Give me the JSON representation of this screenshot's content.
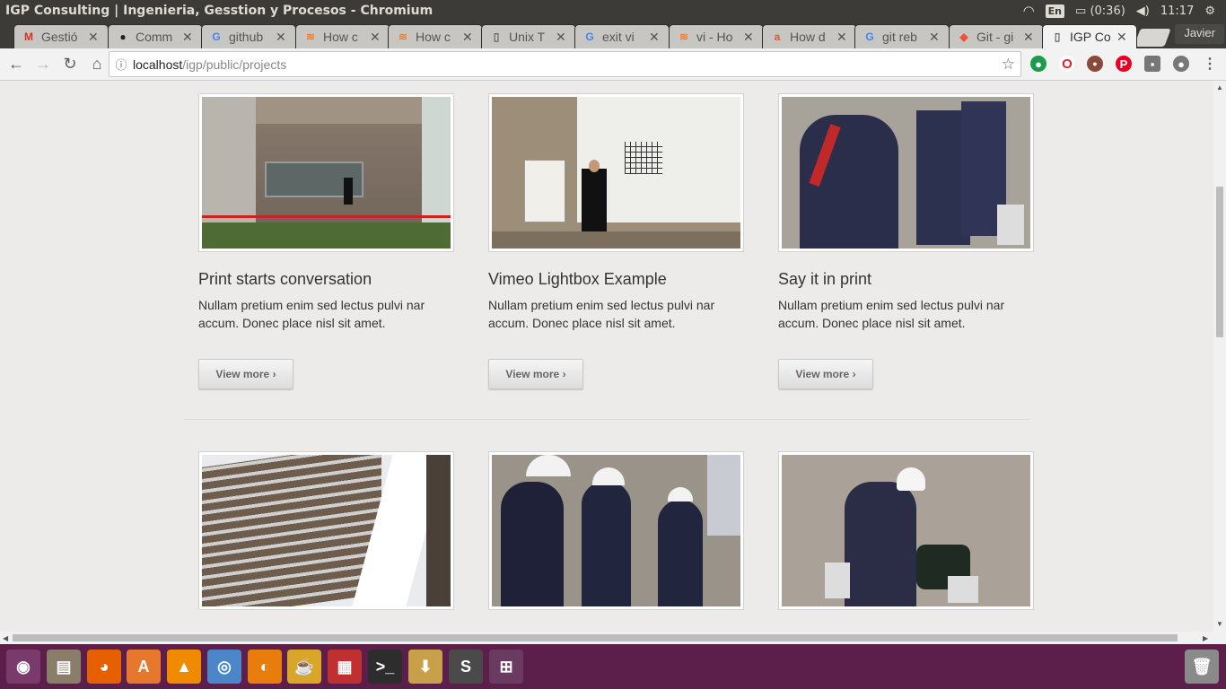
{
  "panel": {
    "window_title": "IGP Consulting | Ingenieria, Gesstion y Procesos - Chromium",
    "language": "En",
    "battery": "(0:36)",
    "clock": "11:17"
  },
  "tabs": [
    {
      "label": "Gestió",
      "icon": "gmail-icon",
      "glyph": "M",
      "color": "#d93025"
    },
    {
      "label": "Comm",
      "icon": "github-icon",
      "glyph": "●",
      "color": "#222222"
    },
    {
      "label": "github",
      "icon": "google-icon",
      "glyph": "G",
      "color": "#4285f4"
    },
    {
      "label": "How c",
      "icon": "stackoverflow-icon",
      "glyph": "≋",
      "color": "#f48024"
    },
    {
      "label": "How c",
      "icon": "stackoverflow-icon",
      "glyph": "≋",
      "color": "#f48024"
    },
    {
      "label": "Unix T",
      "icon": "page-icon",
      "glyph": "▯",
      "color": "#666666"
    },
    {
      "label": "exit vi",
      "icon": "google-icon",
      "glyph": "G",
      "color": "#4285f4"
    },
    {
      "label": "vi - Ho",
      "icon": "stackoverflow-icon",
      "glyph": "≋",
      "color": "#f48024"
    },
    {
      "label": "How d",
      "icon": "askubuntu-icon",
      "glyph": "a",
      "color": "#e95420"
    },
    {
      "label": "git reb",
      "icon": "google-icon",
      "glyph": "G",
      "color": "#4285f4"
    },
    {
      "label": "Git - gi",
      "icon": "git-icon",
      "glyph": "◆",
      "color": "#f05033"
    },
    {
      "label": "IGP Co",
      "icon": "page-icon",
      "glyph": "▯",
      "color": "#666666",
      "active": true
    }
  ],
  "profile_name": "Javier",
  "toolbar": {
    "url_host": "localhost",
    "url_path": "/igp/public/projects"
  },
  "projects": [
    {
      "title": "Print starts conversation",
      "text": "Nullam pretium enim sed lectus pulvi nar accum. Donec place nisl sit amet.",
      "button": "View more ›",
      "scene": "building-facade"
    },
    {
      "title": "Vimeo Lightbox Example",
      "text": "Nullam pretium enim sed lectus pulvi nar accum. Donec place nisl sit amet.",
      "button": "View more ›",
      "scene": "presentation"
    },
    {
      "title": "Say it in print",
      "text": "Nullam pretium enim sed lectus pulvi nar accum. Donec place nisl sit amet.",
      "button": "View more ›",
      "scene": "workers-gear"
    },
    {
      "title": "",
      "text": "",
      "button": "",
      "scene": "tower"
    },
    {
      "title": "",
      "text": "",
      "button": "",
      "scene": "helmets"
    },
    {
      "title": "",
      "text": "",
      "button": "",
      "scene": "worker-wall"
    }
  ],
  "launcher": [
    {
      "name": "ubuntu-dash-icon",
      "glyph": "◉",
      "bg": "#7a3b6c"
    },
    {
      "name": "files-icon",
      "glyph": "▤",
      "bg": "#8a7d6a"
    },
    {
      "name": "firefox-icon",
      "glyph": "◕",
      "bg": "#e66000"
    },
    {
      "name": "software-center-icon",
      "glyph": "A",
      "bg": "#e8772e"
    },
    {
      "name": "vlc-icon",
      "glyph": "▲",
      "bg": "#f08a00"
    },
    {
      "name": "chromium-icon",
      "glyph": "◎",
      "bg": "#4a86c8"
    },
    {
      "name": "blender-icon",
      "glyph": "◐",
      "bg": "#e87d0d"
    },
    {
      "name": "teapot-icon",
      "glyph": "☕",
      "bg": "#d9a62a"
    },
    {
      "name": "multicolor-app-icon",
      "glyph": "▦",
      "bg": "#c03030"
    },
    {
      "name": "terminal-icon",
      "glyph": ">_",
      "bg": "#2d2d2d"
    },
    {
      "name": "installer-icon",
      "glyph": "⬇",
      "bg": "#c8a04a"
    },
    {
      "name": "sublime-text-icon",
      "glyph": "S",
      "bg": "#4a4a4a"
    },
    {
      "name": "workspace-switcher-icon",
      "glyph": "⊞",
      "bg": "#6a3a60"
    }
  ]
}
